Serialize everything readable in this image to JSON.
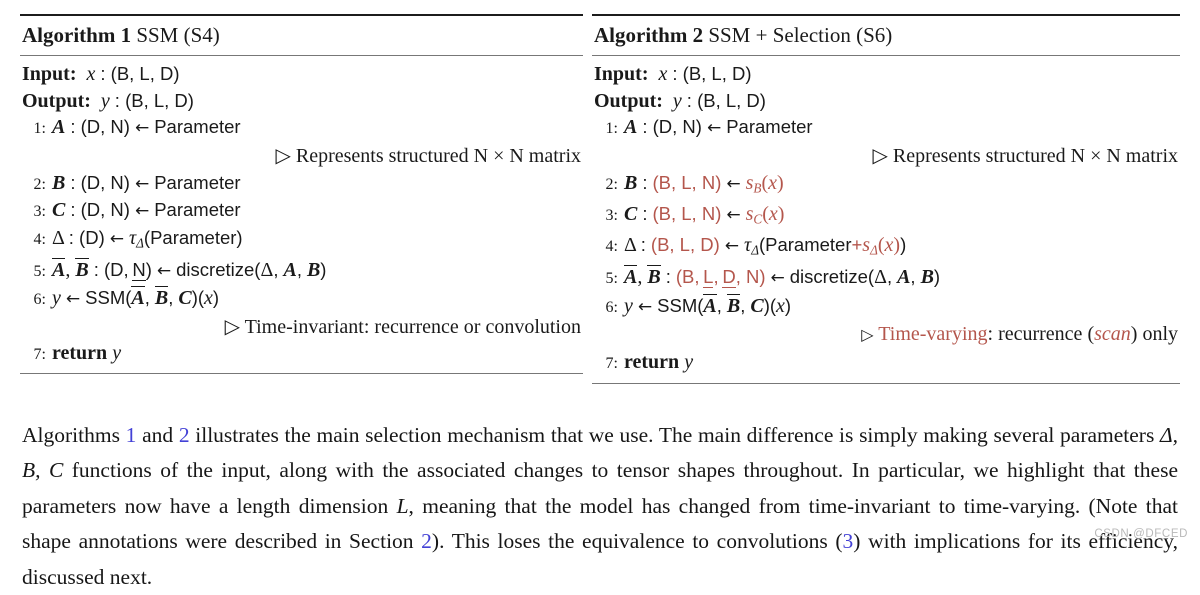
{
  "algorithms": [
    {
      "id": "algorithm-1",
      "title_label": "Algorithm 1",
      "title_rest": "SSM (S4)",
      "input_label": "Input:",
      "input_value": "x : (B, L, D)",
      "output_label": "Output:",
      "output_value": "y : (B, L, D)",
      "steps": [
        {
          "num": "1:",
          "text": "A : (D, N) ← Parameter"
        },
        {
          "num": "2:",
          "text": "B : (D, N) ← Parameter"
        },
        {
          "num": "3:",
          "text": "C : (D, N) ← Parameter"
        },
        {
          "num": "4:",
          "text": "Δ : (D) ← τΔ(Parameter)"
        },
        {
          "num": "5:",
          "text": "A, B : (D, N) ← discretize(Δ, A, B)"
        },
        {
          "num": "6:",
          "text": "y ← SSM(A, B, C)(x)"
        },
        {
          "num": "7:",
          "text": "return y"
        }
      ],
      "comment_1": "▷ Represents structured N × N matrix",
      "comment_2": "▷ Time-invariant: recurrence or convolution",
      "return_label": "return"
    },
    {
      "id": "algorithm-2",
      "title_label": "Algorithm 2",
      "title_rest": "SSM + Selection (S6)",
      "input_label": "Input:",
      "input_value": "x : (B, L, D)",
      "output_label": "Output:",
      "output_value": "y : (B, L, D)",
      "steps": [
        {
          "num": "1:",
          "text": "A : (D, N) ← Parameter"
        },
        {
          "num": "2:",
          "text": "B : (B, L, N) ← sB(x)"
        },
        {
          "num": "3:",
          "text": "C : (B, L, N) ← sC(x)"
        },
        {
          "num": "4:",
          "text": "Δ : (B, L, D) ← τΔ(Parameter+sΔ(x))"
        },
        {
          "num": "5:",
          "text": "A, B : (B, L, D, N) ← discretize(Δ, A, B)"
        },
        {
          "num": "6:",
          "text": "y ← SSM(A, B, C)(x)"
        },
        {
          "num": "7:",
          "text": "return y"
        }
      ],
      "comment_1": "▷ Represents structured N × N matrix",
      "comment_2_tri": "▷",
      "comment_2_red": "Time-varying",
      "comment_2_mid": ": recurrence (",
      "comment_2_scan": "scan",
      "comment_2_tail": ") only",
      "return_label": "return"
    }
  ],
  "paragraph": {
    "seg1": "Algorithms ",
    "ref1": "1",
    "seg2": " and ",
    "ref2": "2",
    "seg3": " illustrates the main selection mechanism that we use. The main difference is simply making several parameters ",
    "math1": "Δ, B, C",
    "seg4": " functions of the input, along with the associated changes to tensor shapes throughout. In particular, we highlight that these parameters now have a length dimension ",
    "math2": "L",
    "seg5": ", meaning that the model has changed from time-invariant to time-varying. (Note that shape annotations were described in Section ",
    "ref3": "2",
    "seg6": "). This loses the equivalence to convolutions (",
    "ref4": "3",
    "seg7": ") with implications for its efficiency, discussed next."
  },
  "watermark": "CSDN @DFCED",
  "colors": {
    "accent_red": "#b4564c",
    "link_blue": "#4341d6",
    "rule_dark": "#1c1c1c",
    "rule_light": "#777777",
    "watermark_gray": "#b9b9b9"
  }
}
